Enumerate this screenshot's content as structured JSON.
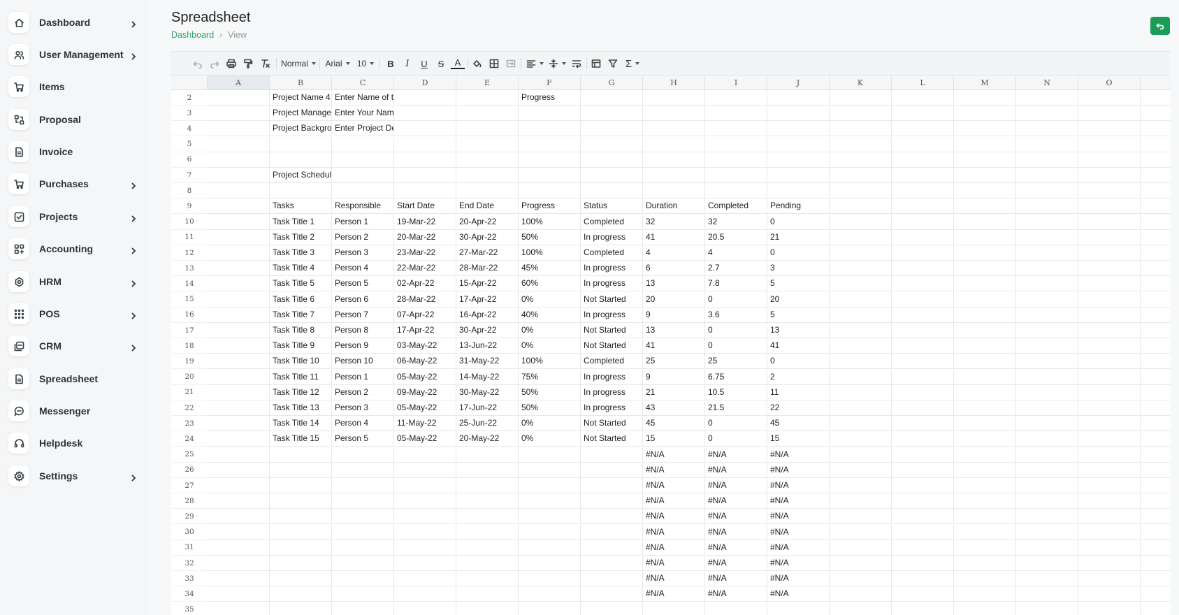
{
  "sidebar": {
    "items": [
      {
        "label": "Dashboard",
        "icon": "home-icon",
        "chevron": true
      },
      {
        "label": "User Management",
        "icon": "users-icon",
        "chevron": true
      },
      {
        "label": "Items",
        "icon": "cart-icon",
        "chevron": false
      },
      {
        "label": "Proposal",
        "icon": "proposal-icon",
        "chevron": false
      },
      {
        "label": "Invoice",
        "icon": "file-icon",
        "chevron": false
      },
      {
        "label": "Purchases",
        "icon": "cart-icon",
        "chevron": true
      },
      {
        "label": "Projects",
        "icon": "check-square-icon",
        "chevron": true
      },
      {
        "label": "Accounting",
        "icon": "apps-icon",
        "chevron": true
      },
      {
        "label": "HRM",
        "icon": "hrm-icon",
        "chevron": true
      },
      {
        "label": "POS",
        "icon": "grid-dots-icon",
        "chevron": true
      },
      {
        "label": "CRM",
        "icon": "crm-icon",
        "chevron": true
      },
      {
        "label": "Spreadsheet",
        "icon": "file-icon",
        "chevron": false
      },
      {
        "label": "Messenger",
        "icon": "message-icon",
        "chevron": false
      },
      {
        "label": "Helpdesk",
        "icon": "headset-icon",
        "chevron": false
      },
      {
        "label": "Settings",
        "icon": "gear-icon",
        "chevron": true
      }
    ]
  },
  "header": {
    "title": "Spreadsheet",
    "breadcrumb": {
      "link": "Dashboard",
      "current": "View"
    }
  },
  "toolbar": {
    "style": "Normal",
    "font": "Arial",
    "size": "10"
  },
  "sheet": {
    "columns": [
      "A",
      "B",
      "C",
      "D",
      "E",
      "F",
      "G",
      "H",
      "I",
      "J",
      "K",
      "L",
      "M",
      "N",
      "O"
    ],
    "rows": [
      {
        "n": "2",
        "cells": {
          "B": "Project Name 4",
          "C": "Enter Name of the",
          "F": "Progress"
        }
      },
      {
        "n": "3",
        "cells": {
          "B": "Project Manager",
          "C": "Enter Your Name"
        }
      },
      {
        "n": "4",
        "cells": {
          "B": "Project Background",
          "C": "Enter Project De"
        }
      },
      {
        "n": "5",
        "cells": {}
      },
      {
        "n": "6",
        "cells": {}
      },
      {
        "n": "7",
        "cells": {
          "B": "Project Schedule"
        }
      },
      {
        "n": "8",
        "cells": {}
      },
      {
        "n": "9",
        "cells": {
          "B": "Tasks",
          "C": "Responsible",
          "D": "Start Date",
          "E": "End Date",
          "F": "Progress",
          "G": "Status",
          "H": "Duration",
          "I": "Completed",
          "J": "Pending"
        }
      },
      {
        "n": "10",
        "cells": {
          "B": "Task Title 1",
          "C": "Person 1",
          "D": "19-Mar-22",
          "E": "20-Apr-22",
          "F": "100%",
          "G": "Completed",
          "H": "32",
          "I": "32",
          "J": "0"
        }
      },
      {
        "n": "11",
        "cells": {
          "B": "Task Title 2",
          "C": "Person 2",
          "D": "20-Mar-22",
          "E": "30-Apr-22",
          "F": "50%",
          "G": "In progress",
          "H": "41",
          "I": "20.5",
          "J": "21"
        }
      },
      {
        "n": "12",
        "cells": {
          "B": "Task Title 3",
          "C": "Person 3",
          "D": "23-Mar-22",
          "E": "27-Mar-22",
          "F": "100%",
          "G": "Completed",
          "H": "4",
          "I": "4",
          "J": "0"
        }
      },
      {
        "n": "13",
        "cells": {
          "B": "Task Title 4",
          "C": "Person 4",
          "D": "22-Mar-22",
          "E": "28-Mar-22",
          "F": "45%",
          "G": "In progress",
          "H": "6",
          "I": "2.7",
          "J": "3"
        }
      },
      {
        "n": "14",
        "cells": {
          "B": "Task Title 5",
          "C": "Person 5",
          "D": "02-Apr-22",
          "E": "15-Apr-22",
          "F": "60%",
          "G": "In progress",
          "H": "13",
          "I": "7.8",
          "J": "5"
        }
      },
      {
        "n": "15",
        "cells": {
          "B": "Task Title 6",
          "C": "Person 6",
          "D": "28-Mar-22",
          "E": "17-Apr-22",
          "F": "0%",
          "G": "Not Started",
          "H": "20",
          "I": "0",
          "J": "20"
        }
      },
      {
        "n": "16",
        "cells": {
          "B": "Task Title 7",
          "C": "Person 7",
          "D": "07-Apr-22",
          "E": "16-Apr-22",
          "F": "40%",
          "G": "In progress",
          "H": "9",
          "I": "3.6",
          "J": "5"
        }
      },
      {
        "n": "17",
        "cells": {
          "B": "Task Title 8",
          "C": "Person 8",
          "D": "17-Apr-22",
          "E": "30-Apr-22",
          "F": "0%",
          "G": "Not Started",
          "H": "13",
          "I": "0",
          "J": "13"
        }
      },
      {
        "n": "18",
        "cells": {
          "B": "Task Title 9",
          "C": "Person 9",
          "D": "03-May-22",
          "E": "13-Jun-22",
          "F": "0%",
          "G": "Not Started",
          "H": "41",
          "I": "0",
          "J": "41"
        }
      },
      {
        "n": "19",
        "cells": {
          "B": "Task Title 10",
          "C": "Person 10",
          "D": "06-May-22",
          "E": "31-May-22",
          "F": "100%",
          "G": "Completed",
          "H": "25",
          "I": "25",
          "J": "0"
        }
      },
      {
        "n": "20",
        "cells": {
          "B": "Task Title 11",
          "C": "Person 1",
          "D": "05-May-22",
          "E": "14-May-22",
          "F": "75%",
          "G": "In progress",
          "H": "9",
          "I": "6.75",
          "J": "2"
        }
      },
      {
        "n": "21",
        "cells": {
          "B": "Task Title 12",
          "C": "Person 2",
          "D": "09-May-22",
          "E": "30-May-22",
          "F": "50%",
          "G": "In progress",
          "H": "21",
          "I": "10.5",
          "J": "11"
        }
      },
      {
        "n": "22",
        "cells": {
          "B": "Task Title 13",
          "C": "Person 3",
          "D": "05-May-22",
          "E": "17-Jun-22",
          "F": "50%",
          "G": "In progress",
          "H": "43",
          "I": "21.5",
          "J": "22"
        }
      },
      {
        "n": "23",
        "cells": {
          "B": "Task Title 14",
          "C": "Person 4",
          "D": "11-May-22",
          "E": "25-Jun-22",
          "F": "0%",
          "G": "Not Started",
          "H": "45",
          "I": "0",
          "J": "45"
        }
      },
      {
        "n": "24",
        "cells": {
          "B": "Task Title 15",
          "C": "Person 5",
          "D": "05-May-22",
          "E": "20-May-22",
          "F": "0%",
          "G": "Not Started",
          "H": "15",
          "I": "0",
          "J": "15"
        }
      },
      {
        "n": "25",
        "cells": {
          "H": "#N/A",
          "I": "#N/A",
          "J": "#N/A"
        }
      },
      {
        "n": "26",
        "cells": {
          "H": "#N/A",
          "I": "#N/A",
          "J": "#N/A"
        }
      },
      {
        "n": "27",
        "cells": {
          "H": "#N/A",
          "I": "#N/A",
          "J": "#N/A"
        }
      },
      {
        "n": "28",
        "cells": {
          "H": "#N/A",
          "I": "#N/A",
          "J": "#N/A"
        }
      },
      {
        "n": "29",
        "cells": {
          "H": "#N/A",
          "I": "#N/A",
          "J": "#N/A"
        }
      },
      {
        "n": "30",
        "cells": {
          "H": "#N/A",
          "I": "#N/A",
          "J": "#N/A"
        }
      },
      {
        "n": "31",
        "cells": {
          "H": "#N/A",
          "I": "#N/A",
          "J": "#N/A"
        }
      },
      {
        "n": "32",
        "cells": {
          "H": "#N/A",
          "I": "#N/A",
          "J": "#N/A"
        }
      },
      {
        "n": "33",
        "cells": {
          "H": "#N/A",
          "I": "#N/A",
          "J": "#N/A"
        }
      },
      {
        "n": "34",
        "cells": {
          "H": "#N/A",
          "I": "#N/A",
          "J": "#N/A"
        }
      },
      {
        "n": "35",
        "cells": {}
      }
    ]
  },
  "colors": {
    "accent": "#2fa36b",
    "button": "#1c9d57"
  }
}
